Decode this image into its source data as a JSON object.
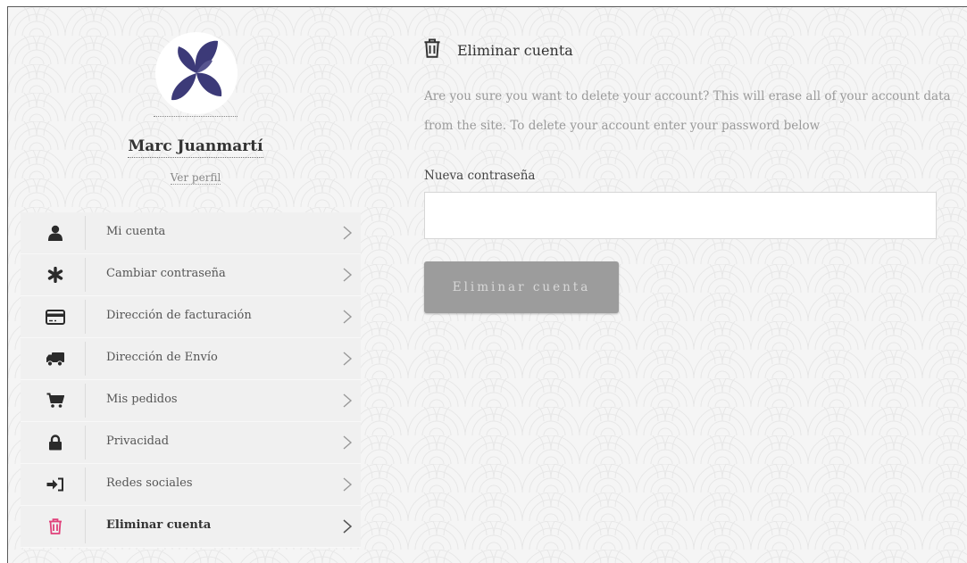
{
  "colors": {
    "accent_active": "#e0407a",
    "icon_dark": "#2b2b2b",
    "avatar_petals": "#3c3a78",
    "button_bg": "#9c9c9c"
  },
  "profile": {
    "name": "Marc Juanmartí",
    "view_profile": "Ver perfil"
  },
  "menu": {
    "items": [
      {
        "label": "Mi cuenta",
        "icon": "user-icon",
        "active": false
      },
      {
        "label": "Cambiar contraseña",
        "icon": "asterisk-icon",
        "active": false
      },
      {
        "label": "Dirección de facturación",
        "icon": "credit-card-icon",
        "active": false
      },
      {
        "label": "Dirección de Envío",
        "icon": "truck-icon",
        "active": false
      },
      {
        "label": "Mis pedidos",
        "icon": "cart-icon",
        "active": false
      },
      {
        "label": "Privacidad",
        "icon": "lock-icon",
        "active": false
      },
      {
        "label": "Redes sociales",
        "icon": "sign-in-icon",
        "active": false
      },
      {
        "label": "Eliminar cuenta",
        "icon": "trash-icon",
        "active": true
      }
    ]
  },
  "main": {
    "title": "Eliminar cuenta",
    "title_icon": "trash-icon",
    "warning": "Are you sure you want to delete your account? This will erase all of your account data from the site. To delete your account enter your password below",
    "field_label": "Nueva contraseña",
    "password_value": "",
    "button_label": "Eliminar cuenta"
  }
}
